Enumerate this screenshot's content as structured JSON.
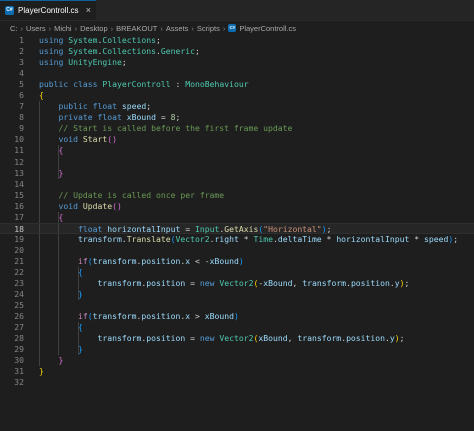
{
  "tab": {
    "icon": "csharp-file-icon",
    "label": "PlayerControll.cs",
    "close_glyph": "×"
  },
  "breadcrumb": {
    "segments": [
      "C:",
      "Users",
      "Michi",
      "Desktop",
      "BREAKOUT",
      "Assets",
      "Scripts"
    ],
    "file": "PlayerControll.cs",
    "separator": "›"
  },
  "editor": {
    "current_line": 18,
    "lines": [
      [
        [
          "kw",
          "using"
        ],
        [
          "pl",
          " "
        ],
        [
          "ty",
          "System"
        ],
        [
          "pl",
          "."
        ],
        [
          "ty",
          "Collections"
        ],
        [
          "pl",
          ";"
        ]
      ],
      [
        [
          "kw",
          "using"
        ],
        [
          "pl",
          " "
        ],
        [
          "ty",
          "System"
        ],
        [
          "pl",
          "."
        ],
        [
          "ty",
          "Collections"
        ],
        [
          "pl",
          "."
        ],
        [
          "ty",
          "Generic"
        ],
        [
          "pl",
          ";"
        ]
      ],
      [
        [
          "kw",
          "using"
        ],
        [
          "pl",
          " "
        ],
        [
          "ty",
          "UnityEngine"
        ],
        [
          "pl",
          ";"
        ]
      ],
      [],
      [
        [
          "kw",
          "public"
        ],
        [
          "pl",
          " "
        ],
        [
          "kw",
          "class"
        ],
        [
          "pl",
          " "
        ],
        [
          "ty",
          "PlayerControll"
        ],
        [
          "pl",
          " : "
        ],
        [
          "ty",
          "MonoBehaviour"
        ]
      ],
      [
        [
          "b1",
          "{"
        ]
      ],
      [
        [
          "pl",
          "    "
        ],
        [
          "kw",
          "public"
        ],
        [
          "pl",
          " "
        ],
        [
          "kw",
          "float"
        ],
        [
          "pl",
          " "
        ],
        [
          "var",
          "speed"
        ],
        [
          "pl",
          ";"
        ]
      ],
      [
        [
          "pl",
          "    "
        ],
        [
          "kw",
          "private"
        ],
        [
          "pl",
          " "
        ],
        [
          "kw",
          "float"
        ],
        [
          "pl",
          " "
        ],
        [
          "var",
          "xBound"
        ],
        [
          "pl",
          " = "
        ],
        [
          "num",
          "8"
        ],
        [
          "pl",
          ";"
        ]
      ],
      [
        [
          "pl",
          "    "
        ],
        [
          "com",
          "// Start is called before the first frame update"
        ]
      ],
      [
        [
          "pl",
          "    "
        ],
        [
          "kw",
          "void"
        ],
        [
          "pl",
          " "
        ],
        [
          "fn",
          "Start"
        ],
        [
          "b2",
          "()"
        ]
      ],
      [
        [
          "pl",
          "    "
        ],
        [
          "b2",
          "{"
        ]
      ],
      [],
      [
        [
          "pl",
          "    "
        ],
        [
          "b2",
          "}"
        ]
      ],
      [],
      [
        [
          "pl",
          "    "
        ],
        [
          "com",
          "// Update is called once per frame"
        ]
      ],
      [
        [
          "pl",
          "    "
        ],
        [
          "kw",
          "void"
        ],
        [
          "pl",
          " "
        ],
        [
          "fn",
          "Update"
        ],
        [
          "b2",
          "()"
        ]
      ],
      [
        [
          "pl",
          "    "
        ],
        [
          "b2",
          "{"
        ]
      ],
      [
        [
          "pl",
          "        "
        ],
        [
          "kw",
          "float"
        ],
        [
          "pl",
          " "
        ],
        [
          "var",
          "horizontalInput"
        ],
        [
          "pl",
          " = "
        ],
        [
          "ty",
          "Input"
        ],
        [
          "pl",
          "."
        ],
        [
          "fn",
          "GetAxis"
        ],
        [
          "b3",
          "("
        ],
        [
          "str",
          "\"Horizontal\""
        ],
        [
          "b3",
          ")"
        ],
        [
          "pl",
          ";"
        ]
      ],
      [
        [
          "pl",
          "        "
        ],
        [
          "var",
          "transform"
        ],
        [
          "pl",
          "."
        ],
        [
          "fn",
          "Translate"
        ],
        [
          "b3",
          "("
        ],
        [
          "ty",
          "Vector2"
        ],
        [
          "pl",
          "."
        ],
        [
          "var",
          "right"
        ],
        [
          "pl",
          " * "
        ],
        [
          "ty",
          "Time"
        ],
        [
          "pl",
          "."
        ],
        [
          "var",
          "deltaTime"
        ],
        [
          "pl",
          " * "
        ],
        [
          "var",
          "horizontalInput"
        ],
        [
          "pl",
          " * "
        ],
        [
          "var",
          "speed"
        ],
        [
          "b3",
          ")"
        ],
        [
          "pl",
          ";"
        ]
      ],
      [],
      [
        [
          "pl",
          "        "
        ],
        [
          "ctl",
          "if"
        ],
        [
          "b3",
          "("
        ],
        [
          "var",
          "transform"
        ],
        [
          "pl",
          "."
        ],
        [
          "var",
          "position"
        ],
        [
          "pl",
          "."
        ],
        [
          "var",
          "x"
        ],
        [
          "pl",
          " < -"
        ],
        [
          "var",
          "xBound"
        ],
        [
          "b3",
          ")"
        ]
      ],
      [
        [
          "pl",
          "        "
        ],
        [
          "b3",
          "{"
        ]
      ],
      [
        [
          "pl",
          "            "
        ],
        [
          "var",
          "transform"
        ],
        [
          "pl",
          "."
        ],
        [
          "var",
          "position"
        ],
        [
          "pl",
          " = "
        ],
        [
          "kw",
          "new"
        ],
        [
          "pl",
          " "
        ],
        [
          "ty",
          "Vector2"
        ],
        [
          "b1",
          "("
        ],
        [
          "pl",
          "-"
        ],
        [
          "var",
          "xBound"
        ],
        [
          "pl",
          ", "
        ],
        [
          "var",
          "transform"
        ],
        [
          "pl",
          "."
        ],
        [
          "var",
          "position"
        ],
        [
          "pl",
          "."
        ],
        [
          "var",
          "y"
        ],
        [
          "b1",
          ")"
        ],
        [
          "pl",
          ";"
        ]
      ],
      [
        [
          "pl",
          "        "
        ],
        [
          "b3",
          "}"
        ]
      ],
      [],
      [
        [
          "pl",
          "        "
        ],
        [
          "ctl",
          "if"
        ],
        [
          "b3",
          "("
        ],
        [
          "var",
          "transform"
        ],
        [
          "pl",
          "."
        ],
        [
          "var",
          "position"
        ],
        [
          "pl",
          "."
        ],
        [
          "var",
          "x"
        ],
        [
          "pl",
          " > "
        ],
        [
          "var",
          "xBound"
        ],
        [
          "b3",
          ")"
        ]
      ],
      [
        [
          "pl",
          "        "
        ],
        [
          "b3",
          "{"
        ]
      ],
      [
        [
          "pl",
          "            "
        ],
        [
          "var",
          "transform"
        ],
        [
          "pl",
          "."
        ],
        [
          "var",
          "position"
        ],
        [
          "pl",
          " = "
        ],
        [
          "kw",
          "new"
        ],
        [
          "pl",
          " "
        ],
        [
          "ty",
          "Vector2"
        ],
        [
          "b1",
          "("
        ],
        [
          "var",
          "xBound"
        ],
        [
          "pl",
          ", "
        ],
        [
          "var",
          "transform"
        ],
        [
          "pl",
          "."
        ],
        [
          "var",
          "position"
        ],
        [
          "pl",
          "."
        ],
        [
          "var",
          "y"
        ],
        [
          "b1",
          ")"
        ],
        [
          "pl",
          ";"
        ]
      ],
      [
        [
          "pl",
          "        "
        ],
        [
          "b3",
          "}"
        ]
      ],
      [
        [
          "pl",
          "    "
        ],
        [
          "b2",
          "}"
        ]
      ],
      [
        [
          "b1",
          "}"
        ]
      ],
      []
    ]
  },
  "colors": {
    "background": "#1e1e1e",
    "accent": "#0e639c",
    "keyword": "#569cd6",
    "type": "#4ec9b0",
    "function": "#dcdcaa",
    "variable": "#9cdcfe",
    "string": "#ce9178",
    "comment": "#6a9955",
    "number": "#b5cea8"
  }
}
